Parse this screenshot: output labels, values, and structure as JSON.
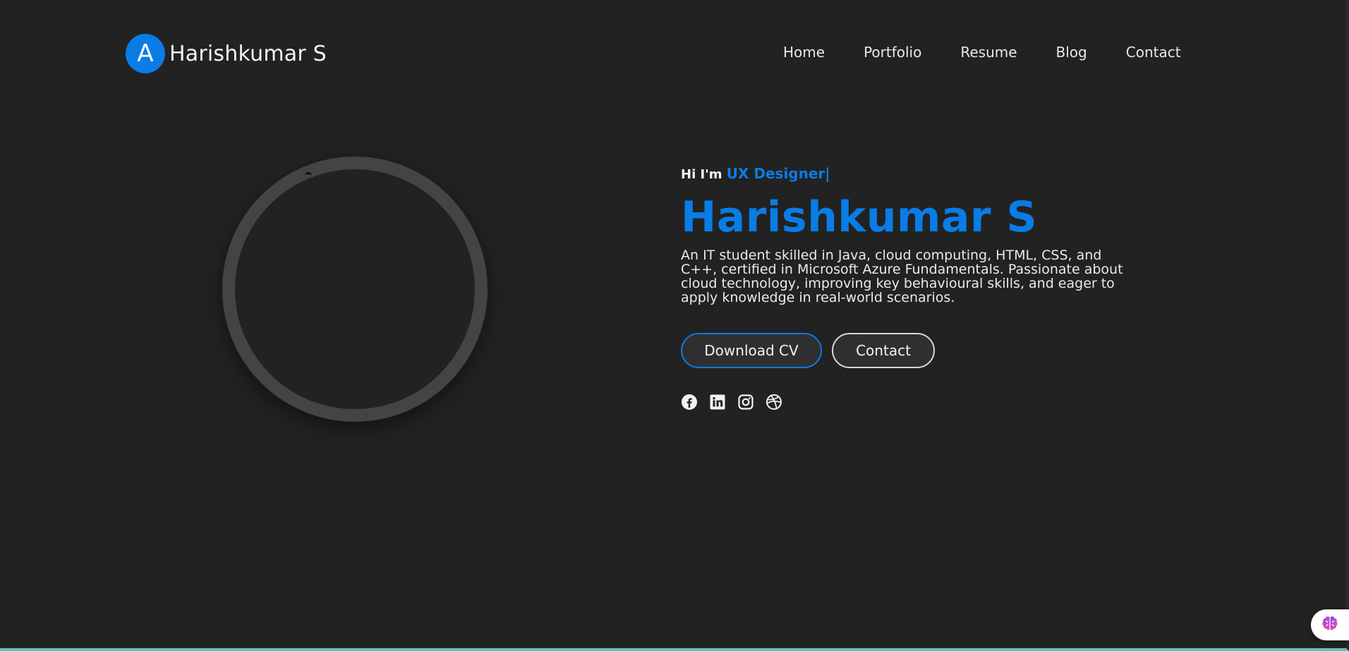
{
  "brand": {
    "initial": "A",
    "name": "Harishkumar S"
  },
  "nav": {
    "items": [
      "Home",
      "Portfolio",
      "Resume",
      "Blog",
      "Contact"
    ]
  },
  "hero": {
    "greeting": "Hi I'm",
    "role": "UX Designer",
    "cursor": "|",
    "name": "Harishkumar S",
    "bio": "An IT student skilled in Java, cloud computing, HTML, CSS, and C++, certified in Microsoft Azure Fundamentals. Passionate about cloud technology, improving key behavioural skills, and eager to apply knowledge in real-world scenarios.",
    "download_label": "Download CV",
    "contact_label": "Contact"
  },
  "socials": [
    "facebook-icon",
    "linkedin-icon",
    "instagram-icon",
    "dribbble-icon"
  ],
  "colors": {
    "accent": "#0a7ce6",
    "background": "#222222",
    "ring": "#444444"
  },
  "widget": {
    "icon": "brain-icon"
  }
}
